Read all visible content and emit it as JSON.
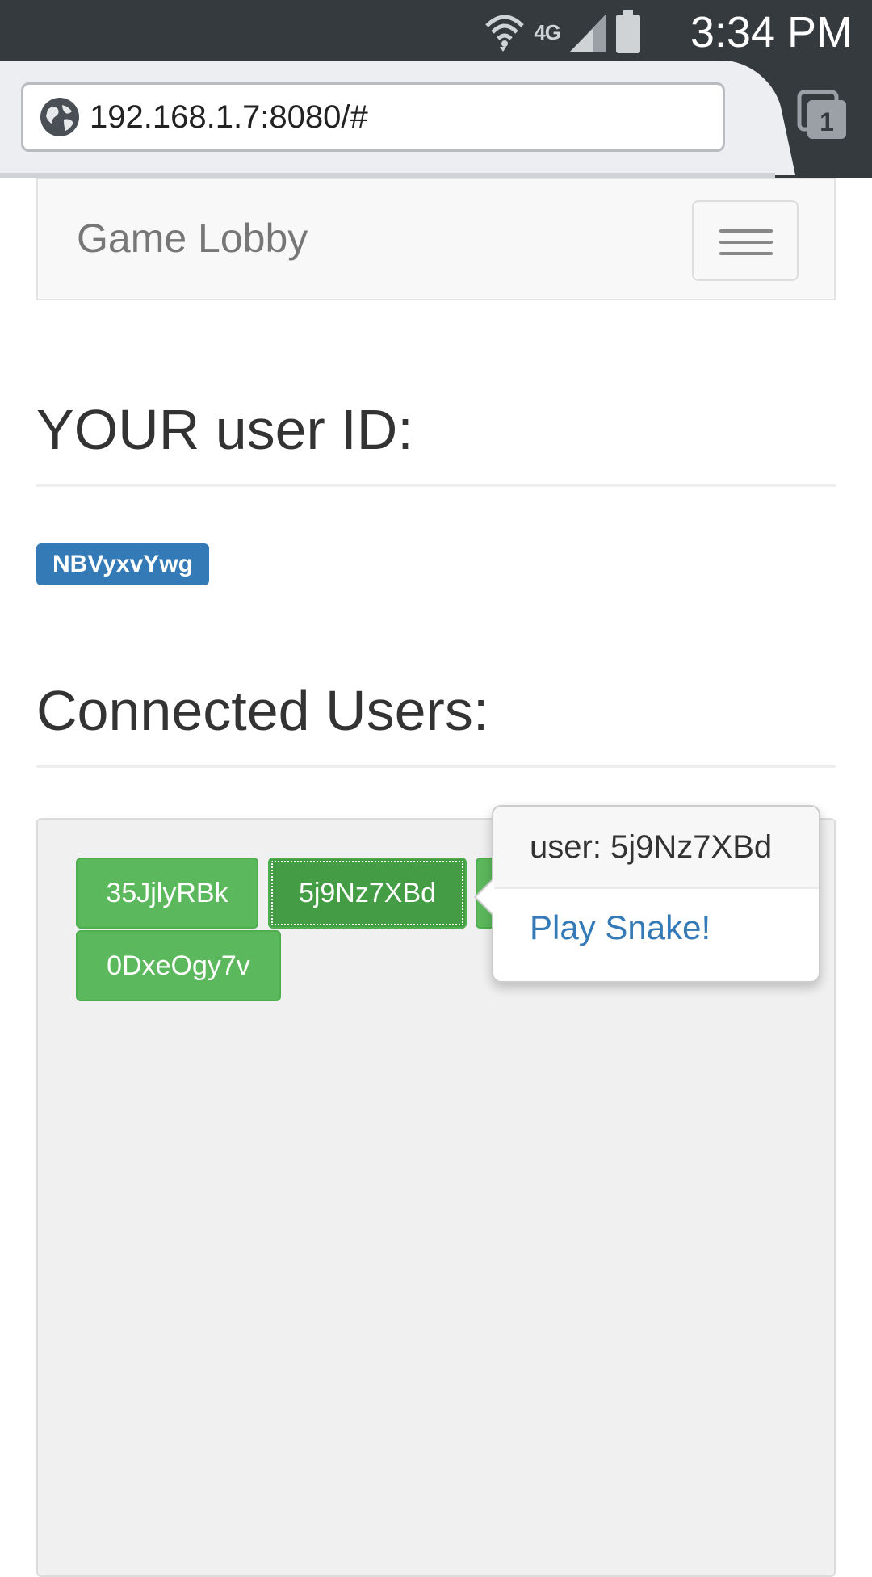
{
  "status_bar": {
    "time": "3:34 PM",
    "network_type": "4G",
    "icons": [
      "wifi-icon",
      "signal-icon",
      "battery-icon"
    ]
  },
  "browser": {
    "url": "192.168.1.7:8080/#",
    "tab_count": "1"
  },
  "navbar": {
    "brand": "Game Lobby"
  },
  "your_id": {
    "heading": "YOUR user ID:",
    "value": "NBVyxvYwg"
  },
  "connected": {
    "heading": "Connected Users:",
    "users": [
      "35JjlyRBk",
      "5j9Nz7XBd",
      "0DxeOgy7v"
    ]
  },
  "popover": {
    "title": "user: 5j9Nz7XBd",
    "action": "Play Snake!"
  },
  "colors": {
    "primary": "#337ab7",
    "success": "#5cb85c",
    "success_active": "#449d44",
    "status_bar": "#353a3f"
  }
}
